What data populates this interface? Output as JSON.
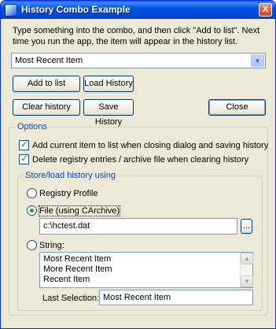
{
  "window": {
    "title": "History Combo Example",
    "close_glyph": "X",
    "icon": "app-icon"
  },
  "instructions": "Type something into the combo, and then click \"Add to list\". Next time you run the app, the item will appear in the history list.",
  "combo": {
    "value": "Most Recent Item",
    "dropdown_icon": "chevron-down-icon"
  },
  "buttons": {
    "add_to_list": "Add to list",
    "load_history": "Load History",
    "clear_history": "Clear history",
    "save_history": "Save History",
    "close": "Close"
  },
  "options": {
    "label": "Options",
    "add_current": {
      "label": "Add current item to list when closing dialog and saving history",
      "checked": true
    },
    "delete_registry": {
      "label": "Delete registry entries / archive file when clearing history",
      "checked": true
    }
  },
  "store": {
    "label": "Store/load history using",
    "registry": {
      "label": "Registry Profile",
      "checked": false
    },
    "file": {
      "label": "File (using CArchive)",
      "checked": true,
      "path": "c:\\hctest.dat",
      "browse_label": "..."
    },
    "string": {
      "label": "String:",
      "checked": false,
      "items": [
        "Most Recent Item",
        "More Recent Item",
        "Recent Item"
      ],
      "last_selection_label": "Last Selection:",
      "last_selection_value": "Most Recent Item"
    }
  }
}
